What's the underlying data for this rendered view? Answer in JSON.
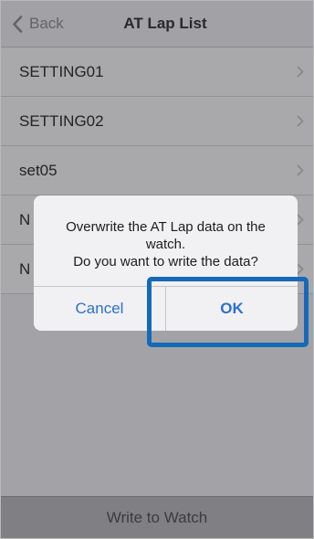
{
  "nav": {
    "back_label": "Back",
    "title": "AT Lap List"
  },
  "list": {
    "items": [
      {
        "label": "SETTING01"
      },
      {
        "label": "SETTING02"
      },
      {
        "label": "set05"
      },
      {
        "label": "N"
      },
      {
        "label": "N"
      }
    ]
  },
  "toolbar": {
    "write_label": "Write to Watch"
  },
  "alert": {
    "line1": "Overwrite the AT Lap data on the",
    "line2": "watch.",
    "line3": "Do you want to write the data?",
    "cancel_label": "Cancel",
    "ok_label": "OK"
  },
  "colors": {
    "accent_blue": "#2d6fd0",
    "highlight_blue": "#1469b8",
    "back_gray": "#8a8a8e"
  },
  "icons": {
    "back": "chevron-left-icon",
    "row": "chevron-right-icon"
  }
}
